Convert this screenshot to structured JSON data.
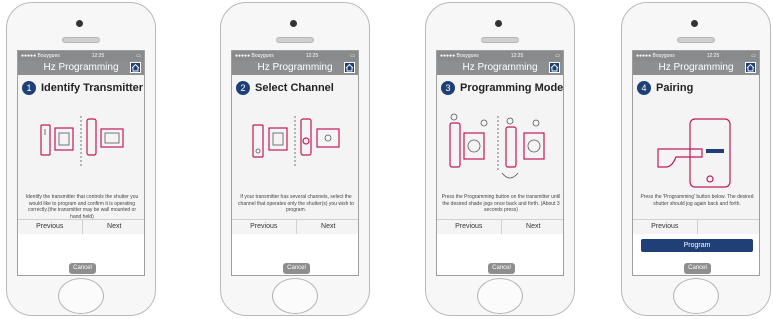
{
  "status": {
    "carrier": "●●●●● Bouygues",
    "time": "12:25"
  },
  "app_title": "Hz Programming",
  "colors": {
    "accent": "#1f3f77",
    "illustration": "#c2185b",
    "navbar": "#8c8e90"
  },
  "screens": [
    {
      "step": "1",
      "title": "Identify Transmitter",
      "description": "Identify the transmitter that controls the shutter you would like to program and confirm it is operating correctly.(the transmitter may be wall mounted or hand held)",
      "previous": "Previous",
      "next": "Next",
      "cancel": "Cancel"
    },
    {
      "step": "2",
      "title": "Select Channel",
      "description": "If your transmitter has several channels, select the channel that operates only the shutter(s) you wish to program.",
      "previous": "Previous",
      "next": "Next",
      "cancel": "Cancel"
    },
    {
      "step": "3",
      "title": "Programming Mode",
      "description": "Press the Programming button on the transmitter until the desired shade jogs once back and forth. (About 3 seconds press)",
      "previous": "Previous",
      "next": "Next",
      "cancel": "Cancel"
    },
    {
      "step": "4",
      "title": "Pairing",
      "description": "Press the 'Programming' button below. The desired shutter should jog again back and forth.",
      "previous": "Previous",
      "program": "Program",
      "cancel": "Cancel"
    }
  ]
}
